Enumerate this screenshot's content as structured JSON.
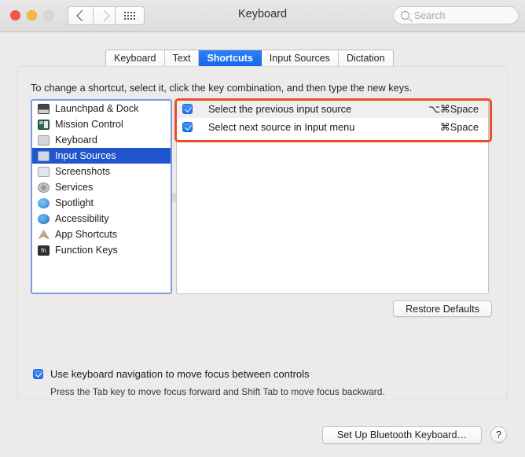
{
  "window": {
    "title": "Keyboard",
    "traffic_lights": [
      "close",
      "minimize",
      "zoom"
    ],
    "nav_back": "back-arrow",
    "nav_forward": "forward-arrow",
    "show_all": "grid-icon"
  },
  "search": {
    "placeholder": "Search",
    "value": "",
    "icon": "search-icon"
  },
  "tabs": [
    {
      "label": "Keyboard",
      "active": false
    },
    {
      "label": "Text",
      "active": false
    },
    {
      "label": "Shortcuts",
      "active": true
    },
    {
      "label": "Input Sources",
      "active": false
    },
    {
      "label": "Dictation",
      "active": false
    }
  ],
  "instruction": "To change a shortcut, select it, click the key combination, and then type the new keys.",
  "sidebar": {
    "items": [
      {
        "label": "Launchpad & Dock",
        "icon": "launchpad-dock-icon",
        "selected": false
      },
      {
        "label": "Mission Control",
        "icon": "mission-control-icon",
        "selected": false
      },
      {
        "label": "Keyboard",
        "icon": "keyboard-icon",
        "selected": false
      },
      {
        "label": "Input Sources",
        "icon": "input-sources-icon",
        "selected": true
      },
      {
        "label": "Screenshots",
        "icon": "screenshots-icon",
        "selected": false
      },
      {
        "label": "Services",
        "icon": "services-gear-icon",
        "selected": false
      },
      {
        "label": "Spotlight",
        "icon": "spotlight-icon",
        "selected": false
      },
      {
        "label": "Accessibility",
        "icon": "accessibility-icon",
        "selected": false
      },
      {
        "label": "App Shortcuts",
        "icon": "app-shortcuts-icon",
        "selected": false
      },
      {
        "label": "Function Keys",
        "icon": "function-keys-icon",
        "selected": false
      }
    ]
  },
  "shortcuts": {
    "rows": [
      {
        "checked": true,
        "label": "Select the previous input source",
        "key": "⌥⌘Space"
      },
      {
        "checked": true,
        "label": "Select next source in Input menu",
        "key": "⌘Space"
      }
    ]
  },
  "annotation": {
    "color": "#e8502a",
    "shape": "rectangle-highlight"
  },
  "buttons": {
    "restore_defaults": "Restore Defaults",
    "setup_bluetooth": "Set Up Bluetooth Keyboard…",
    "help": "?"
  },
  "keyboard_navigation": {
    "checked": true,
    "label": "Use keyboard navigation to move focus between controls",
    "hint": "Press the Tab key to move focus forward and Shift Tab to move focus backward."
  },
  "colors": {
    "accent_blue": "#1169ec",
    "selection_blue": "#2155cd",
    "focus_ring": "#7f9be0",
    "annotation_red": "#e8502a"
  }
}
